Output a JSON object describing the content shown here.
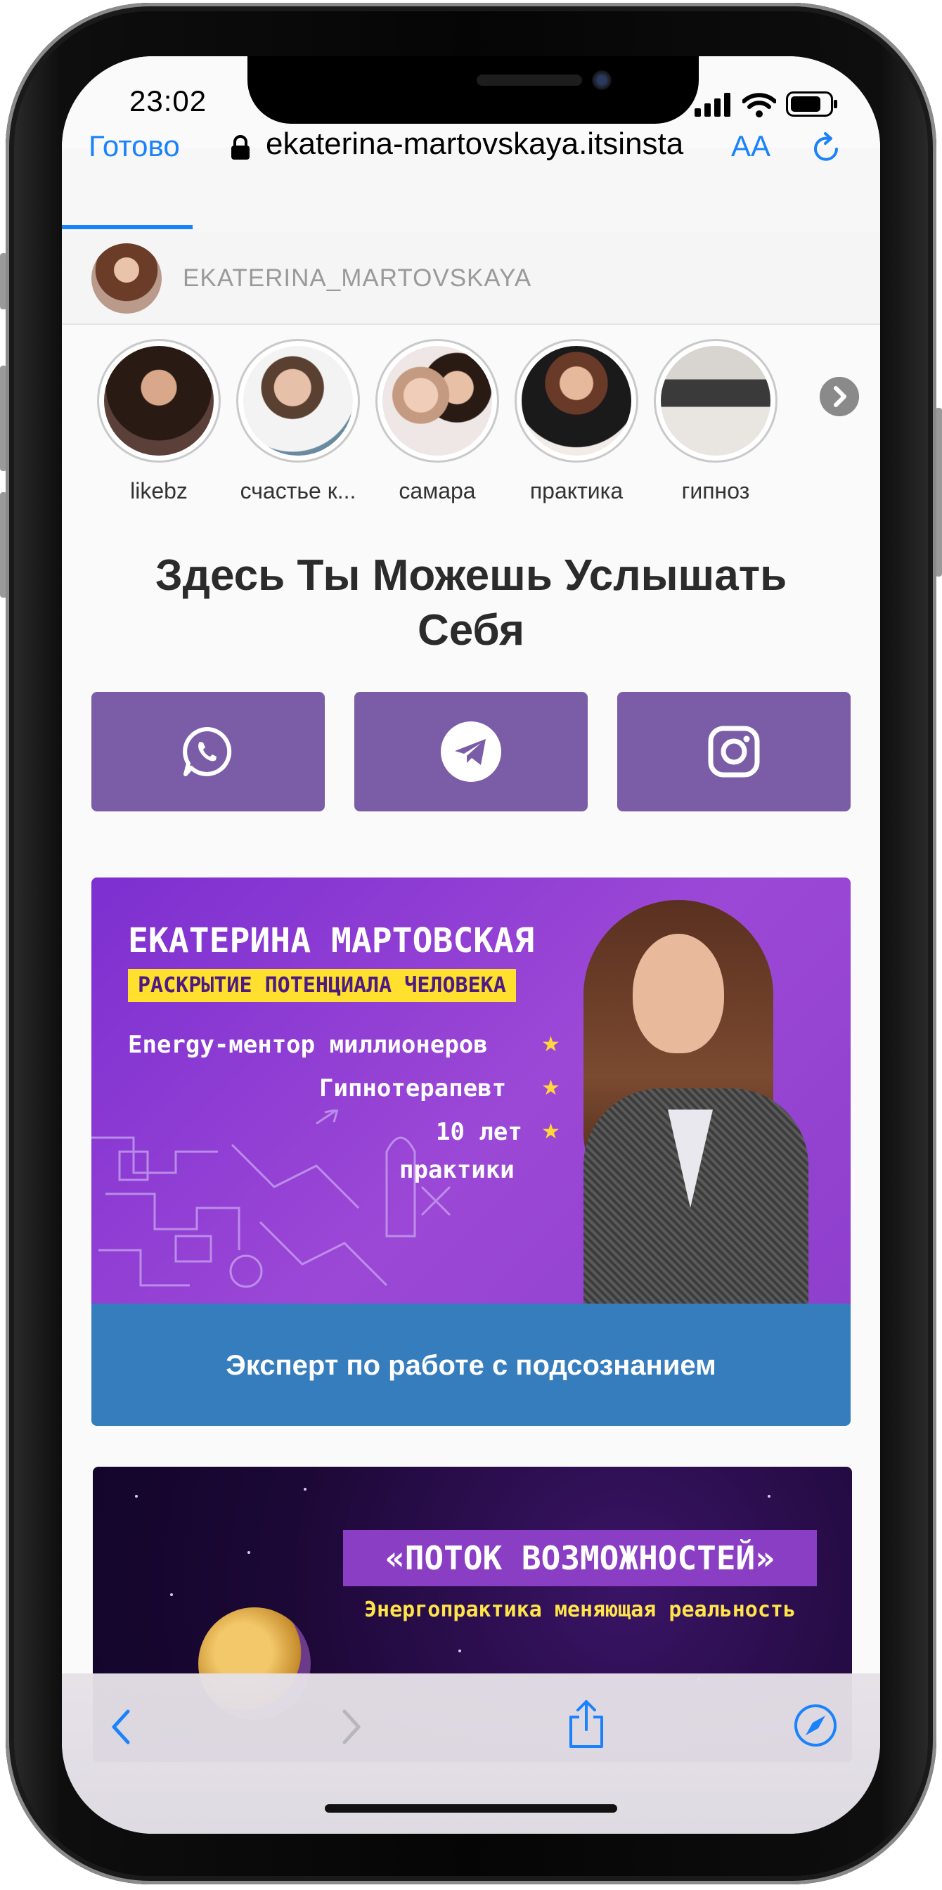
{
  "status_bar": {
    "time": "23:02"
  },
  "browser": {
    "done_label": "Готово",
    "url": "ekaterina-martovskaya.itsinsta",
    "text_size_label": "AA"
  },
  "profile": {
    "username": "EKATERINA_MARTOVSKAYA"
  },
  "stories": [
    {
      "label": "likebz"
    },
    {
      "label": "счастье к..."
    },
    {
      "label": "самара"
    },
    {
      "label": "практика"
    },
    {
      "label": "гипноз"
    }
  ],
  "headline": "Здесь Ты Можешь Услышать Себя",
  "social_buttons": [
    {
      "icon": "whatsapp-icon"
    },
    {
      "icon": "telegram-icon"
    },
    {
      "icon": "instagram-icon"
    }
  ],
  "banner1": {
    "name": "ЕКАТЕРИНА МАРТОВСКАЯ",
    "tagline": "РАСКРЫТИЕ ПОТЕНЦИАЛА ЧЕЛОВЕКА",
    "line1": "Energy-ментор миллионеров",
    "line2": "Гипнотерапевт",
    "line3a": "10 лет",
    "line3b": "практики",
    "caption": "Эксперт по работе с подсознанием"
  },
  "banner2": {
    "title": "«ПОТОК ВОЗМОЖНОСТЕЙ»",
    "subtitle": "Энергопрактика меняющая реальность"
  },
  "colors": {
    "accent_blue": "#1a82fb",
    "button_purple": "#7a5da6",
    "caption_blue": "#367dbd",
    "highlight_yellow": "#ffe02e"
  }
}
